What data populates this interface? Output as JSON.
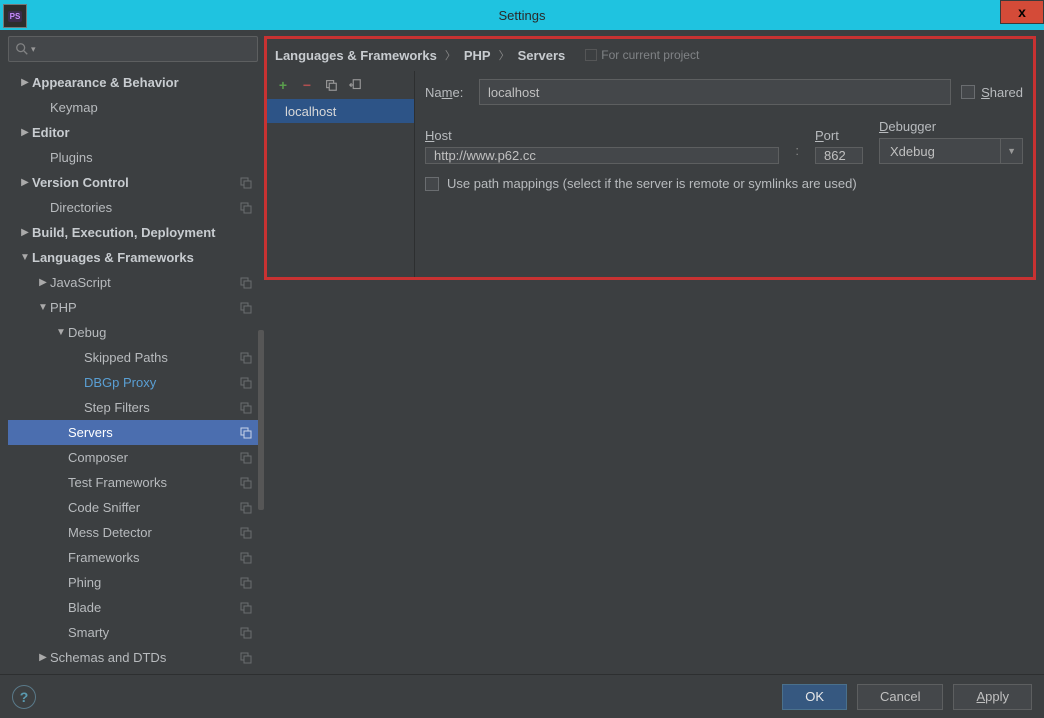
{
  "window": {
    "title": "Settings",
    "close": "x"
  },
  "tree": {
    "items": [
      {
        "label": "Appearance & Behavior",
        "bold": true,
        "arrow": "▶",
        "indent": 0
      },
      {
        "label": "Keymap",
        "indent": 1
      },
      {
        "label": "Editor",
        "bold": true,
        "arrow": "▶",
        "indent": 0
      },
      {
        "label": "Plugins",
        "indent": 1
      },
      {
        "label": "Version Control",
        "bold": true,
        "arrow": "▶",
        "indent": 0,
        "tag": true
      },
      {
        "label": "Directories",
        "indent": 1,
        "tag": true
      },
      {
        "label": "Build, Execution, Deployment",
        "bold": true,
        "arrow": "▶",
        "indent": 0
      },
      {
        "label": "Languages & Frameworks",
        "bold": true,
        "arrow": "▼",
        "indent": 0
      },
      {
        "label": "JavaScript",
        "arrow": "▶",
        "indent": 1,
        "tag": true
      },
      {
        "label": "PHP",
        "arrow": "▼",
        "indent": 1,
        "tag": true
      },
      {
        "label": "Debug",
        "arrow": "▼",
        "indent": 2
      },
      {
        "label": "Skipped Paths",
        "indent": 3,
        "tag": true
      },
      {
        "label": "DBGp Proxy",
        "indent": 3,
        "tag": true,
        "link": true
      },
      {
        "label": "Step Filters",
        "indent": 3,
        "tag": true
      },
      {
        "label": "Servers",
        "indent": 2,
        "tag": true,
        "selected": true
      },
      {
        "label": "Composer",
        "indent": 2,
        "tag": true
      },
      {
        "label": "Test Frameworks",
        "indent": 2,
        "tag": true
      },
      {
        "label": "Code Sniffer",
        "indent": 2,
        "tag": true
      },
      {
        "label": "Mess Detector",
        "indent": 2,
        "tag": true
      },
      {
        "label": "Frameworks",
        "indent": 2,
        "tag": true
      },
      {
        "label": "Phing",
        "indent": 2,
        "tag": true
      },
      {
        "label": "Blade",
        "indent": 2,
        "tag": true
      },
      {
        "label": "Smarty",
        "indent": 2,
        "tag": true
      },
      {
        "label": "Schemas and DTDs",
        "arrow": "▶",
        "indent": 1,
        "tag": true
      }
    ]
  },
  "breadcrumb": {
    "a": "Languages & Frameworks",
    "b": "PHP",
    "c": "Servers",
    "proj": "For current project"
  },
  "serverlist": {
    "item": "localhost"
  },
  "form": {
    "name_label": "Name:",
    "name_value": "localhost",
    "shared": "Shared",
    "host_label": "Host",
    "host_value": "http://www.p62.cc",
    "port_label": "Port",
    "port_value": "862",
    "debugger_label": "Debugger",
    "debugger_value": "Xdebug",
    "pathmap": "Use path mappings (select if the server is remote or symlinks are used)"
  },
  "buttons": {
    "ok": "OK",
    "cancel": "Cancel",
    "apply": "Apply"
  }
}
